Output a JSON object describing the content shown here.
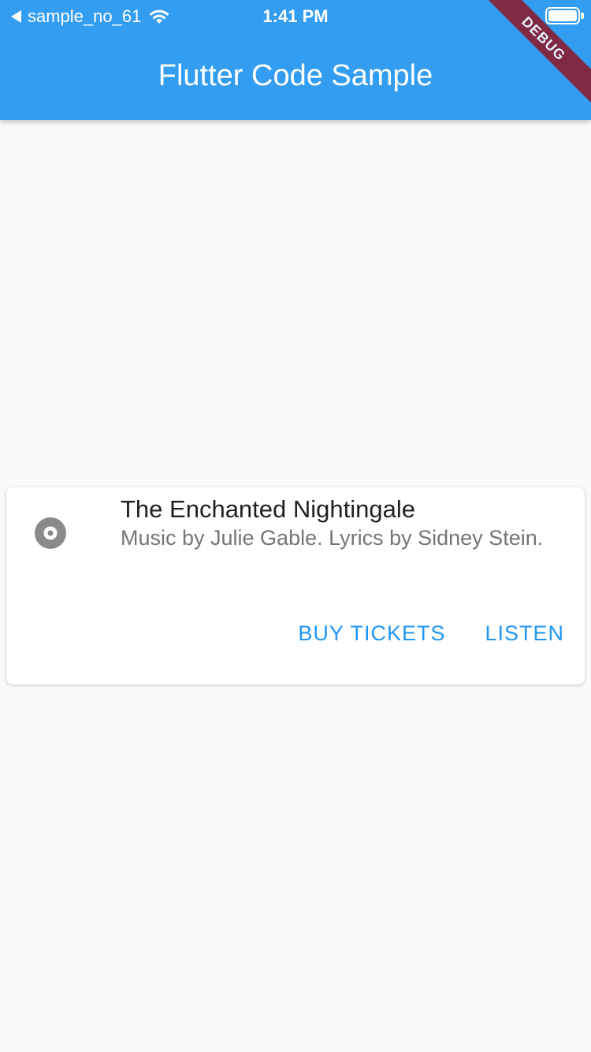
{
  "status_bar": {
    "back_app": "sample_no_61",
    "time": "1:41 PM"
  },
  "app_bar": {
    "title": "Flutter Code Sample"
  },
  "debug_banner": "DEBUG",
  "card": {
    "icon": "album-icon",
    "title": "The Enchanted Nightingale",
    "subtitle": "Music by Julie Gable. Lyrics by Sidney Stein.",
    "actions": [
      "BUY TICKETS",
      "LISTEN"
    ]
  },
  "colors": {
    "app_bar": "#339df2",
    "background": "#fafafa",
    "accent": "#2196f3",
    "debug_banner": "#8b1a2c"
  }
}
